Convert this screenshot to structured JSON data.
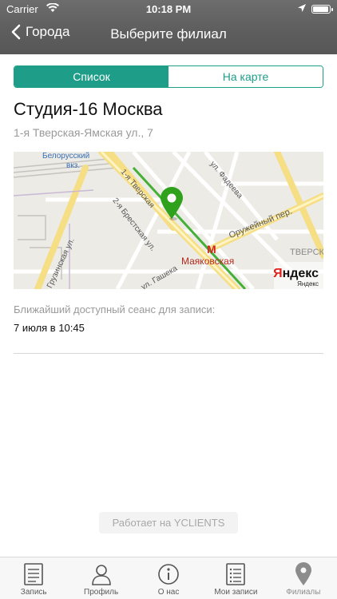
{
  "status": {
    "carrier": "Carrier",
    "time": "10:18 PM"
  },
  "nav": {
    "back_label": "Города",
    "title": "Выберите филиал"
  },
  "segment": {
    "items": [
      "Список",
      "На карте"
    ],
    "selected": "Список"
  },
  "branch": {
    "name": "Студия-16 Москва",
    "address": "1-я Тверская-Ямская ул., 7"
  },
  "map": {
    "labels": {
      "station1": "Белорусский",
      "station1b": "вкз.",
      "street1": "1-я Тверская",
      "street2": "ул. Фадеева",
      "street3": "2-я Брестская ул.",
      "street4": "Оружейный пер.",
      "street5": "Грузинская ул.",
      "street6": "ул. Гашека",
      "metro": "Маяковская",
      "district": "ТВЕРСК"
    },
    "brand": "Яндекс"
  },
  "nearest": {
    "label": "Ближайший доступный сеанс для записи:",
    "value": "7 июля в 10:45"
  },
  "powered_by": "Работает на YCLIENTS",
  "tabbar": {
    "items": [
      {
        "label": "Запись",
        "icon": "document-icon"
      },
      {
        "label": "Профиль",
        "icon": "person-icon"
      },
      {
        "label": "О нас",
        "icon": "info-icon"
      },
      {
        "label": "Мои записи",
        "icon": "list-icon"
      },
      {
        "label": "Филиалы",
        "icon": "location-pin-icon"
      }
    ],
    "active": "Филиалы"
  },
  "colors": {
    "accent": "#1e9d88",
    "header": "#5e5e5e",
    "pin": "#2fa11d"
  }
}
